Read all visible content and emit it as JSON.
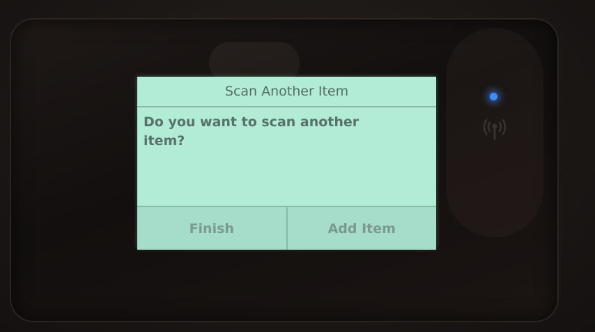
{
  "dialog": {
    "title": "Scan Another Item",
    "message": "Do you want to scan another item?",
    "buttons": {
      "finish_label": "Finish",
      "add_item_label": "Add Item"
    }
  },
  "indicators": {
    "status_led_color": "#3f8cff",
    "wireless_icon": "wireless-icon"
  }
}
